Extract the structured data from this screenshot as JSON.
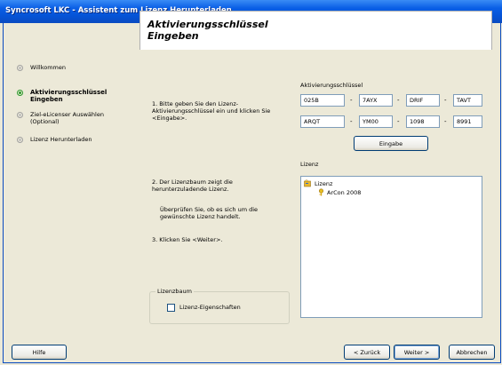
{
  "window": {
    "title": "Syncrosoft LKC - Assistent zum Lizenz Herunterladen"
  },
  "sidebar": {
    "steps": [
      {
        "label": "Willkommen",
        "active": false
      },
      {
        "label": "Aktivierungsschlüssel Eingeben",
        "active": true
      },
      {
        "label": "Ziel-eLicenser Auswählen (Optional)",
        "active": false
      },
      {
        "label": "Lizenz Herunterladen",
        "active": false
      }
    ]
  },
  "main": {
    "heading": "Aktivierungsschlüssel Eingeben",
    "step1_text": "1.  Bitte geben Sie den Lizenz-Aktivierungsschlüssel ein und klicken Sie <Eingabe>.",
    "key_label": "Aktivierungsschlüssel",
    "key_row1": [
      "025B",
      "7AYX",
      "DRIF",
      "TAVT"
    ],
    "key_row2": [
      "ARQT",
      "YM00",
      "1098",
      "8991"
    ],
    "separator": "-",
    "eingabe_button": "Eingabe",
    "step2_text": "2.  Der Lizenzbaum zeigt die herunterzuladende Lizenz.",
    "step2_note": "Überprüfen Sie, ob es sich um die gewünschte Lizenz handelt.",
    "step3_text": "3.  Klicken Sie <Weiter>.",
    "license_label": "Lizenz",
    "tree": {
      "root": "Lizenz",
      "child": "ArCon 2008",
      "root_icon": "license-folder-icon",
      "child_icon": "key-icon"
    },
    "groupbox_title": "Lizenzbaum",
    "checkbox_label": "Lizenz-Eigenschaften",
    "checkbox_checked": false
  },
  "footer": {
    "help": "Hilfe",
    "back": "< Zurück",
    "next": "Weiter >",
    "cancel": "Abbrechen"
  },
  "colors": {
    "titlebar": "#0553d6",
    "active_step": "#2a9a2a",
    "face": "#ece9d8"
  }
}
